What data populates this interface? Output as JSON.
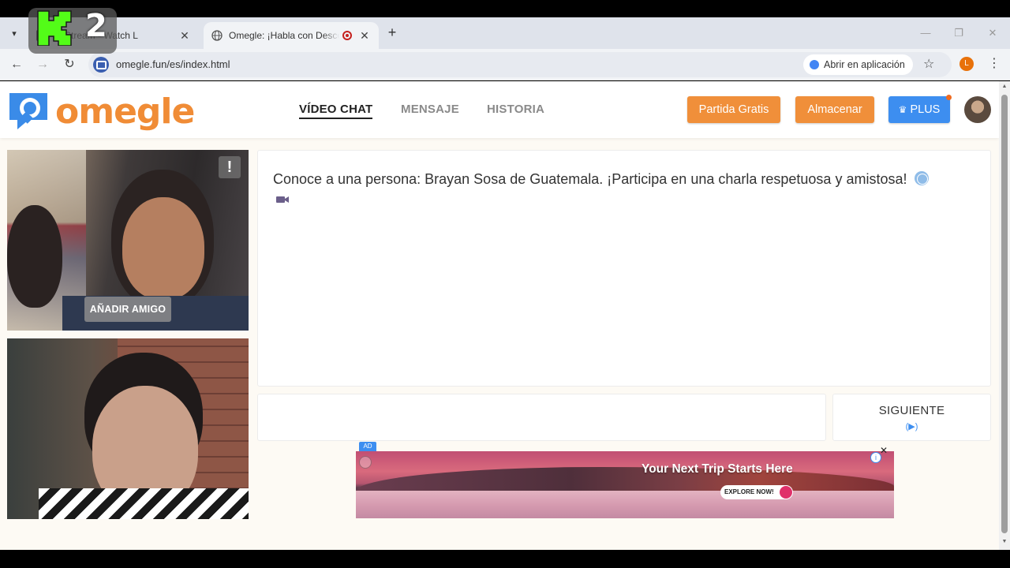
{
  "browser": {
    "tabs": [
      {
        "title": "tF Stream - Watch L",
        "active": false
      },
      {
        "title": "Omegle: ¡Habla con Descon",
        "active": true
      }
    ],
    "url": "omegle.fun/es/index.html",
    "open_in_app_label": "Abrir en aplicación",
    "profile_initial": "L"
  },
  "site": {
    "logo_text": "omegle",
    "nav": [
      {
        "label": "VÍDEO CHAT",
        "active": true
      },
      {
        "label": "MENSAJE",
        "active": false
      },
      {
        "label": "HISTORIA",
        "active": false
      }
    ],
    "buttons": {
      "free_match": "Partida Gratis",
      "store": "Almacenar",
      "plus": "PLUS"
    }
  },
  "video": {
    "report_symbol": "!",
    "add_friend_label": "AÑADIR AMIGO"
  },
  "chat": {
    "message": "Conoce a una persona: Brayan Sosa de Guatemala. ¡Participa en una charla respetuosa y amistosa!"
  },
  "next": {
    "label": "SIGUIENTE",
    "sub": "(▶)"
  },
  "ad": {
    "badge": "AD",
    "headline": "Your Next Trip Starts Here",
    "cta": "EXPLORE NOW!"
  },
  "overlay": {
    "number": "2"
  },
  "colors": {
    "brand_orange": "#f08f3a",
    "plus_blue": "#3d8ef0",
    "logo_blue": "#3a8be8"
  }
}
